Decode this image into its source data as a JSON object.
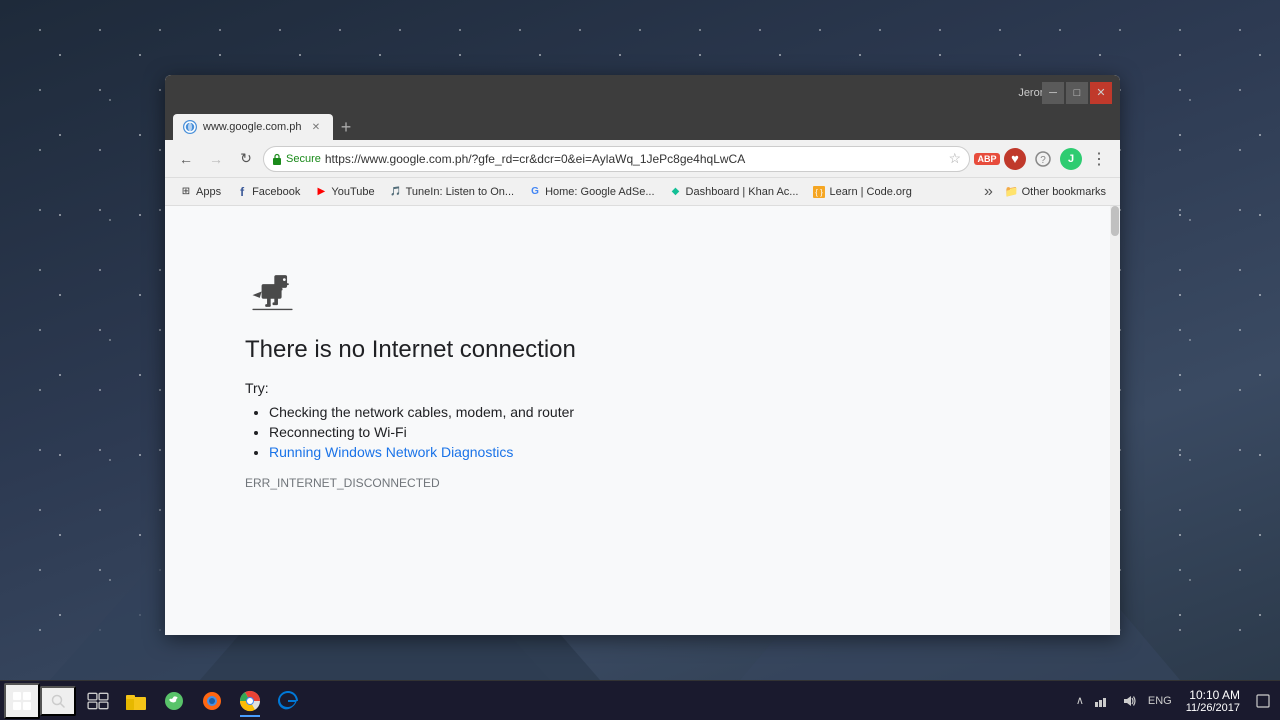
{
  "desktop": {
    "background": "#2d3a52"
  },
  "browser": {
    "titlebar": {
      "profile": "Jerome",
      "minimize": "─",
      "maximize": "□",
      "close": "✕"
    },
    "tab": {
      "favicon": "🌐",
      "title": "www.google.com.ph",
      "close": "✕"
    },
    "toolbar": {
      "back": "←",
      "forward": "→",
      "reload": "↻",
      "secure_label": "Secure",
      "url": "https://www.google.com.ph/?gfe_rd=cr&dcr=0&ei=AylaWq_1JePc8ge4hqLwCA",
      "star": "☆",
      "abp": "ABP",
      "menu": "⋮"
    },
    "bookmarks": [
      {
        "icon": "⊞",
        "label": "Apps"
      },
      {
        "icon": "f",
        "label": "Facebook",
        "color": "#3b5998"
      },
      {
        "icon": "▶",
        "label": "YouTube",
        "color": "#ff0000"
      },
      {
        "icon": "♪",
        "label": "TuneIn: Listen to On...",
        "color": "#00aeef"
      },
      {
        "icon": "G",
        "label": "Home: Google AdSe...",
        "color": "#4285f4"
      },
      {
        "icon": "◆",
        "label": "Dashboard | Khan Ac...",
        "color": "#14bf96"
      },
      {
        "icon": "{ }",
        "label": "Learn | Code.org",
        "color": "#f5a623"
      }
    ],
    "bookmarks_more": "»",
    "other_bookmarks_icon": "📁",
    "other_bookmarks_label": "Other bookmarks"
  },
  "error_page": {
    "title": "There is no Internet connection",
    "try_label": "Try:",
    "suggestions": [
      "Checking the network cables, modem, and router",
      "Reconnecting to Wi-Fi"
    ],
    "link_text": "Running Windows Network Diagnostics",
    "error_code": "ERR_INTERNET_DISCONNECTED"
  },
  "taskbar": {
    "start_tooltip": "Start",
    "search_tooltip": "Search",
    "apps": [
      {
        "name": "task-view",
        "icon": "⧉"
      },
      {
        "name": "file-explorer",
        "icon": "📁",
        "color": "#f5c518"
      },
      {
        "name": "firefox",
        "icon": "🦊"
      },
      {
        "name": "chrome",
        "icon": "⬤",
        "active": true
      },
      {
        "name": "edge",
        "icon": "e"
      }
    ],
    "systray": {
      "chevron": "∧",
      "network": "🖧",
      "volume": "🔊",
      "language": "ENG",
      "time": "10:10 AM",
      "date": "11/26/2017",
      "notification": "□"
    }
  }
}
